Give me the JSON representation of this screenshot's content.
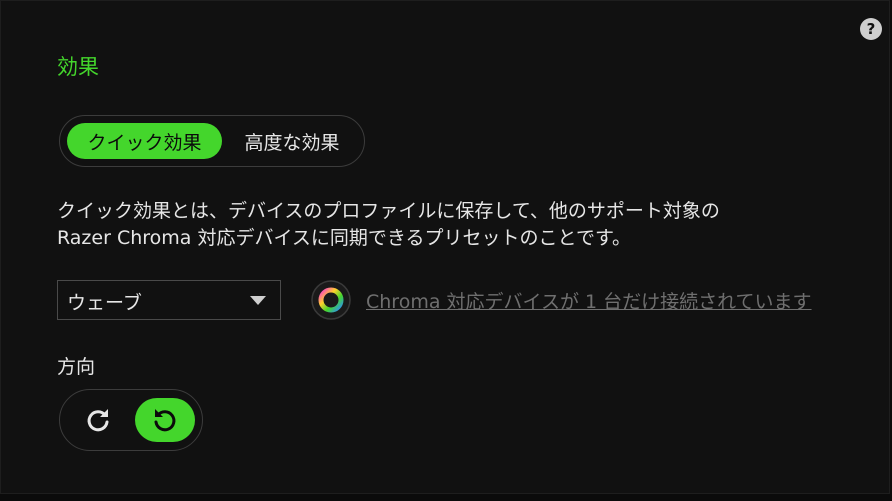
{
  "header": {
    "help_label": "?",
    "section_title": "効果"
  },
  "effect_mode": {
    "options": [
      {
        "label": "クイック効果",
        "selected": true
      },
      {
        "label": "高度な効果",
        "selected": false
      }
    ]
  },
  "description": {
    "line1": "クイック効果とは、デバイスのプロファイルに保存して、他のサポート対象の",
    "line2": "Razer Chroma 対応デバイスに同期できるプリセットのことです。"
  },
  "effect_select": {
    "value": "ウェーブ"
  },
  "chroma_status": {
    "icon": "chroma-icon",
    "text": "Chroma 対応デバイスが 1 台だけ接続されています"
  },
  "direction": {
    "label": "方向",
    "options": [
      {
        "icon": "rotate-clockwise-icon",
        "selected": false
      },
      {
        "icon": "rotate-counterclockwise-icon",
        "selected": true
      }
    ]
  },
  "colors": {
    "accent": "#44d62c",
    "background": "#111111",
    "text": "#e6e6e6",
    "muted_text": "#6f6f6f",
    "border": "#3c3c3c"
  }
}
